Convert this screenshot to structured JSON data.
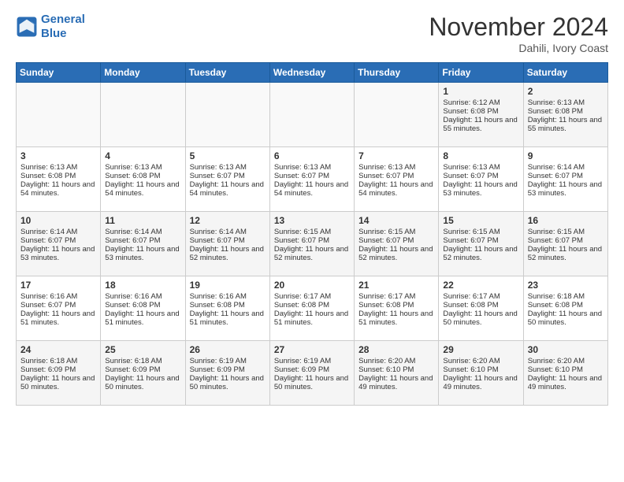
{
  "logo": {
    "line1": "General",
    "line2": "Blue"
  },
  "header": {
    "month": "November 2024",
    "location": "Dahili, Ivory Coast"
  },
  "days_of_week": [
    "Sunday",
    "Monday",
    "Tuesday",
    "Wednesday",
    "Thursday",
    "Friday",
    "Saturday"
  ],
  "weeks": [
    [
      {
        "day": "",
        "info": ""
      },
      {
        "day": "",
        "info": ""
      },
      {
        "day": "",
        "info": ""
      },
      {
        "day": "",
        "info": ""
      },
      {
        "day": "",
        "info": ""
      },
      {
        "day": "1",
        "info": "Sunrise: 6:12 AM\nSunset: 6:08 PM\nDaylight: 11 hours and 55 minutes."
      },
      {
        "day": "2",
        "info": "Sunrise: 6:13 AM\nSunset: 6:08 PM\nDaylight: 11 hours and 55 minutes."
      }
    ],
    [
      {
        "day": "3",
        "info": "Sunrise: 6:13 AM\nSunset: 6:08 PM\nDaylight: 11 hours and 54 minutes."
      },
      {
        "day": "4",
        "info": "Sunrise: 6:13 AM\nSunset: 6:08 PM\nDaylight: 11 hours and 54 minutes."
      },
      {
        "day": "5",
        "info": "Sunrise: 6:13 AM\nSunset: 6:07 PM\nDaylight: 11 hours and 54 minutes."
      },
      {
        "day": "6",
        "info": "Sunrise: 6:13 AM\nSunset: 6:07 PM\nDaylight: 11 hours and 54 minutes."
      },
      {
        "day": "7",
        "info": "Sunrise: 6:13 AM\nSunset: 6:07 PM\nDaylight: 11 hours and 54 minutes."
      },
      {
        "day": "8",
        "info": "Sunrise: 6:13 AM\nSunset: 6:07 PM\nDaylight: 11 hours and 53 minutes."
      },
      {
        "day": "9",
        "info": "Sunrise: 6:14 AM\nSunset: 6:07 PM\nDaylight: 11 hours and 53 minutes."
      }
    ],
    [
      {
        "day": "10",
        "info": "Sunrise: 6:14 AM\nSunset: 6:07 PM\nDaylight: 11 hours and 53 minutes."
      },
      {
        "day": "11",
        "info": "Sunrise: 6:14 AM\nSunset: 6:07 PM\nDaylight: 11 hours and 53 minutes."
      },
      {
        "day": "12",
        "info": "Sunrise: 6:14 AM\nSunset: 6:07 PM\nDaylight: 11 hours and 52 minutes."
      },
      {
        "day": "13",
        "info": "Sunrise: 6:15 AM\nSunset: 6:07 PM\nDaylight: 11 hours and 52 minutes."
      },
      {
        "day": "14",
        "info": "Sunrise: 6:15 AM\nSunset: 6:07 PM\nDaylight: 11 hours and 52 minutes."
      },
      {
        "day": "15",
        "info": "Sunrise: 6:15 AM\nSunset: 6:07 PM\nDaylight: 11 hours and 52 minutes."
      },
      {
        "day": "16",
        "info": "Sunrise: 6:15 AM\nSunset: 6:07 PM\nDaylight: 11 hours and 52 minutes."
      }
    ],
    [
      {
        "day": "17",
        "info": "Sunrise: 6:16 AM\nSunset: 6:07 PM\nDaylight: 11 hours and 51 minutes."
      },
      {
        "day": "18",
        "info": "Sunrise: 6:16 AM\nSunset: 6:08 PM\nDaylight: 11 hours and 51 minutes."
      },
      {
        "day": "19",
        "info": "Sunrise: 6:16 AM\nSunset: 6:08 PM\nDaylight: 11 hours and 51 minutes."
      },
      {
        "day": "20",
        "info": "Sunrise: 6:17 AM\nSunset: 6:08 PM\nDaylight: 11 hours and 51 minutes."
      },
      {
        "day": "21",
        "info": "Sunrise: 6:17 AM\nSunset: 6:08 PM\nDaylight: 11 hours and 51 minutes."
      },
      {
        "day": "22",
        "info": "Sunrise: 6:17 AM\nSunset: 6:08 PM\nDaylight: 11 hours and 50 minutes."
      },
      {
        "day": "23",
        "info": "Sunrise: 6:18 AM\nSunset: 6:08 PM\nDaylight: 11 hours and 50 minutes."
      }
    ],
    [
      {
        "day": "24",
        "info": "Sunrise: 6:18 AM\nSunset: 6:09 PM\nDaylight: 11 hours and 50 minutes."
      },
      {
        "day": "25",
        "info": "Sunrise: 6:18 AM\nSunset: 6:09 PM\nDaylight: 11 hours and 50 minutes."
      },
      {
        "day": "26",
        "info": "Sunrise: 6:19 AM\nSunset: 6:09 PM\nDaylight: 11 hours and 50 minutes."
      },
      {
        "day": "27",
        "info": "Sunrise: 6:19 AM\nSunset: 6:09 PM\nDaylight: 11 hours and 50 minutes."
      },
      {
        "day": "28",
        "info": "Sunrise: 6:20 AM\nSunset: 6:10 PM\nDaylight: 11 hours and 49 minutes."
      },
      {
        "day": "29",
        "info": "Sunrise: 6:20 AM\nSunset: 6:10 PM\nDaylight: 11 hours and 49 minutes."
      },
      {
        "day": "30",
        "info": "Sunrise: 6:20 AM\nSunset: 6:10 PM\nDaylight: 11 hours and 49 minutes."
      }
    ]
  ]
}
